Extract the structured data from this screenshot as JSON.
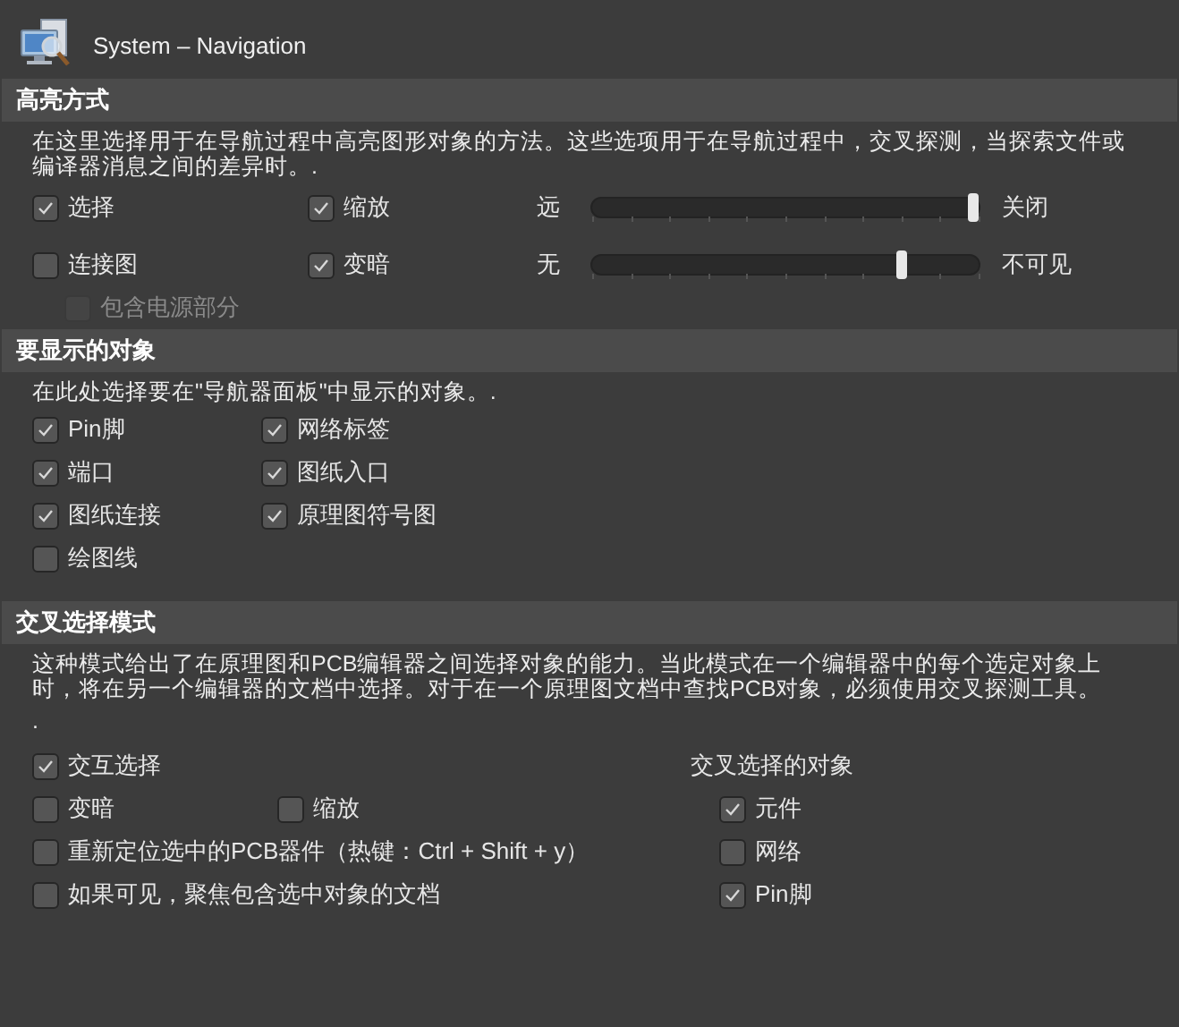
{
  "window": {
    "title": "System – Navigation"
  },
  "highlight": {
    "title": "高亮方式",
    "description": "在这里选择用于在导航过程中高亮图形对象的方法。这些选项用于在导航过程中，交叉探测，当探索文件或编译器消息之间的差异时。.",
    "options": [
      {
        "label": "选择",
        "checked": true
      },
      {
        "label": "缩放",
        "checked": true
      },
      {
        "label": "连接图",
        "checked": false
      },
      {
        "label": "变暗",
        "checked": true
      }
    ],
    "sliders": [
      {
        "label": "远",
        "level": 1,
        "reading": "关闭"
      },
      {
        "label": "无",
        "level": 0.8,
        "reading": "不可见"
      }
    ],
    "sub_option": {
      "label": "包含电源部分",
      "checked": false,
      "disabled": true
    }
  },
  "objects": {
    "title": "要显示的对象",
    "description": "在此处选择要在\"导航器面板\"中显示的对象。.",
    "items": [
      {
        "label": "Pin脚",
        "checked": true
      },
      {
        "label": "网络标签",
        "checked": true
      },
      {
        "label": "端口",
        "checked": true
      },
      {
        "label": "图纸入口",
        "checked": true
      },
      {
        "label": "图纸连接",
        "checked": true
      },
      {
        "label": "原理图符号图",
        "checked": true
      },
      {
        "label": "绘图线",
        "checked": false
      }
    ]
  },
  "cross": {
    "title": "交叉选择模式",
    "description_lines": [
      "这种模式给出了在原理图和PCB编辑器之间选择对象的能力。当此模式在一个编辑器中的每个选定对象上时，将在另一个编辑器的文档中选择。对于在一个原理图文档中查找PCB对象，必须使用交叉探测工具。",
      "."
    ],
    "rows": [
      [
        {
          "label": "交互选择",
          "checked": true
        }
      ],
      [
        {
          "label": "变暗",
          "checked": false
        },
        {
          "label": "缩放",
          "checked": false
        }
      ],
      [
        {
          "label": "重新定位选中的PCB器件（热键：Ctrl + Shift + y）",
          "checked": false
        }
      ],
      [
        {
          "label": "如果可见，聚焦包含选中对象的文档",
          "checked": false
        }
      ]
    ],
    "objects_title": "交叉选择的对象",
    "objects": [
      {
        "label": "元件",
        "checked": true
      },
      {
        "label": "网络",
        "checked": false
      },
      {
        "label": "Pin脚",
        "checked": true
      }
    ]
  }
}
